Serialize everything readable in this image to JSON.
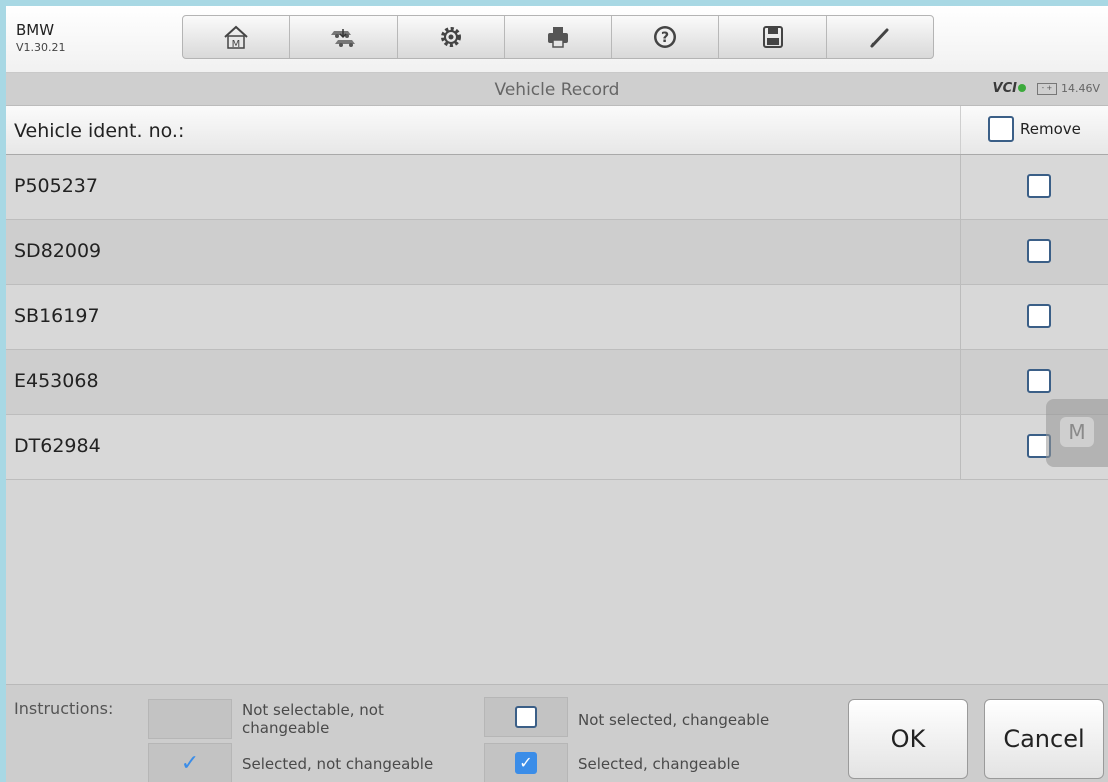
{
  "app": {
    "name": "BMW",
    "version": "V1.30.21"
  },
  "toolbar": {
    "buttons": [
      {
        "icon": "home-icon"
      },
      {
        "icon": "vehicle-swap-icon"
      },
      {
        "icon": "gear-icon"
      },
      {
        "icon": "printer-icon"
      },
      {
        "icon": "help-icon"
      },
      {
        "icon": "save-icon"
      },
      {
        "icon": "pen-icon"
      }
    ]
  },
  "titlebar": {
    "title": "Vehicle Record",
    "vci": "VCI",
    "voltage": "14.46V",
    "battery_glyph": "- +"
  },
  "table": {
    "header": "Vehicle ident. no.:",
    "remove_label": "Remove",
    "rows": [
      {
        "vin": "P505237",
        "checked": false
      },
      {
        "vin": "SD82009",
        "checked": false
      },
      {
        "vin": "SB16197",
        "checked": false
      },
      {
        "vin": "E453068",
        "checked": false
      },
      {
        "vin": "DT62984",
        "checked": false
      }
    ]
  },
  "float_button": {
    "label": "M"
  },
  "footer": {
    "instructions_label": "Instructions:",
    "legend": {
      "not_selectable": "Not selectable, not changeable",
      "selected_not_changeable": "Selected, not changeable",
      "not_selected_changeable": "Not selected, changeable",
      "selected_changeable": "Selected, changeable"
    },
    "check_glyph": "✓",
    "ok_label": "OK",
    "cancel_label": "Cancel"
  },
  "colors": {
    "frame_border": "#a8d8e4",
    "checkbox_border": "#3b5f87",
    "check_accent": "#3b8de8"
  }
}
